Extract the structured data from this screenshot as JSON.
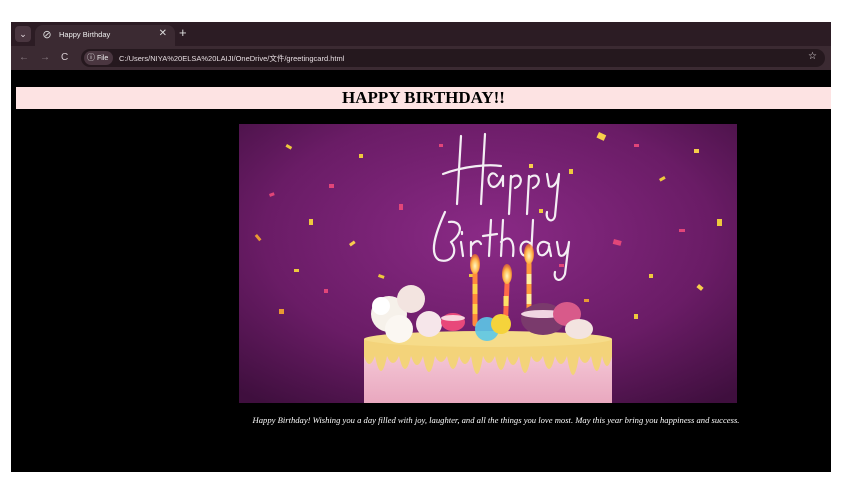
{
  "browser": {
    "tab": {
      "title": "Happy Birthday",
      "favicon_icon": "globe-icon",
      "close_glyph": "✕"
    },
    "new_tab_glyph": "+",
    "tab_menu_glyph": "⌄",
    "nav": {
      "back_glyph": "←",
      "forward_glyph": "→",
      "reload_glyph": "C"
    },
    "site_chip_label": "File",
    "url": "C:/Users/NIYA%20ELSA%20LAIJI/OneDrive/文件/greetingcard.html",
    "bookmark_glyph": "☆"
  },
  "page": {
    "heading": "HAPPY BIRTHDAY!!",
    "image": {
      "lettering": "Happy Birthday",
      "subject": "birthday cake with lit candles, macarons and confetti on purple background"
    },
    "message": "Happy Birthday! Wishing you a day filled with joy, laughter, and all the things you love most. May this year bring you happiness and success."
  },
  "colors": {
    "tab_strip": "#2c1c24",
    "toolbar": "#3b2a32",
    "page_bg": "#000000",
    "heading_bg": "#fde3e3",
    "image_purple": "#6a1c66",
    "frosting": "#f4c0d2",
    "drip": "#f3d37a"
  }
}
